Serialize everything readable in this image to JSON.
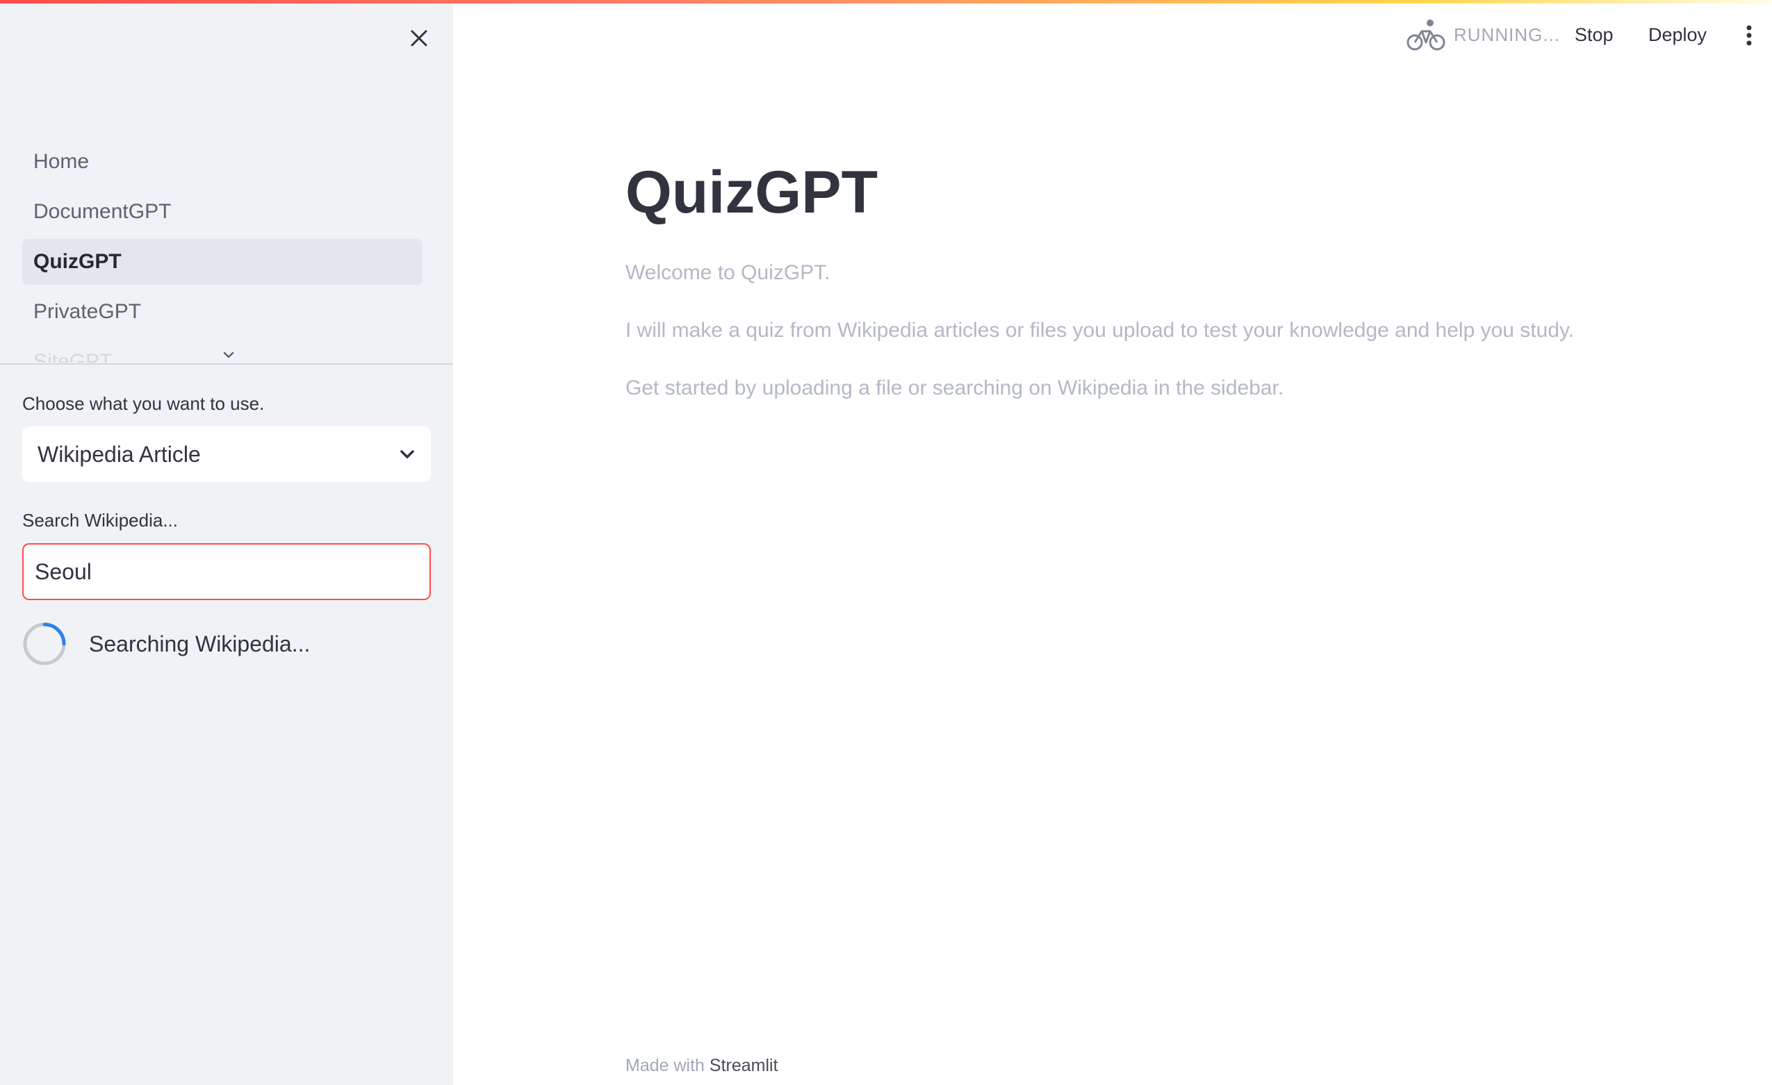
{
  "header": {
    "status": "RUNNING...",
    "stop_label": "Stop",
    "deploy_label": "Deploy",
    "status_icon": "bicycle-icon",
    "menu_icon": "kebab-menu-icon"
  },
  "sidebar": {
    "close_icon": "close-icon",
    "nav": [
      {
        "label": "Home",
        "active": false
      },
      {
        "label": "DocumentGPT",
        "active": false
      },
      {
        "label": "QuizGPT",
        "active": true
      },
      {
        "label": "PrivateGPT",
        "active": false
      },
      {
        "label": "SiteGPT",
        "active": false
      }
    ],
    "choose_label": "Choose what you want to use.",
    "choose_value": "Wikipedia Article",
    "search_label": "Search Wikipedia...",
    "search_value": "Seoul",
    "spinner_text": "Searching Wikipedia..."
  },
  "main": {
    "title": "QuizGPT",
    "paragraphs": [
      "Welcome to QuizGPT.",
      "I will make a quiz from Wikipedia articles or files you upload to test your knowledge and help you study.",
      "Get started by uploading a file or searching on Wikipedia in the sidebar."
    ]
  },
  "footer": {
    "prefix": "Made with",
    "brand": "Streamlit"
  },
  "colors": {
    "accent": "#ff4b4b",
    "sidebar_bg": "#f0f2f6",
    "spinner": "#2f80ed"
  }
}
